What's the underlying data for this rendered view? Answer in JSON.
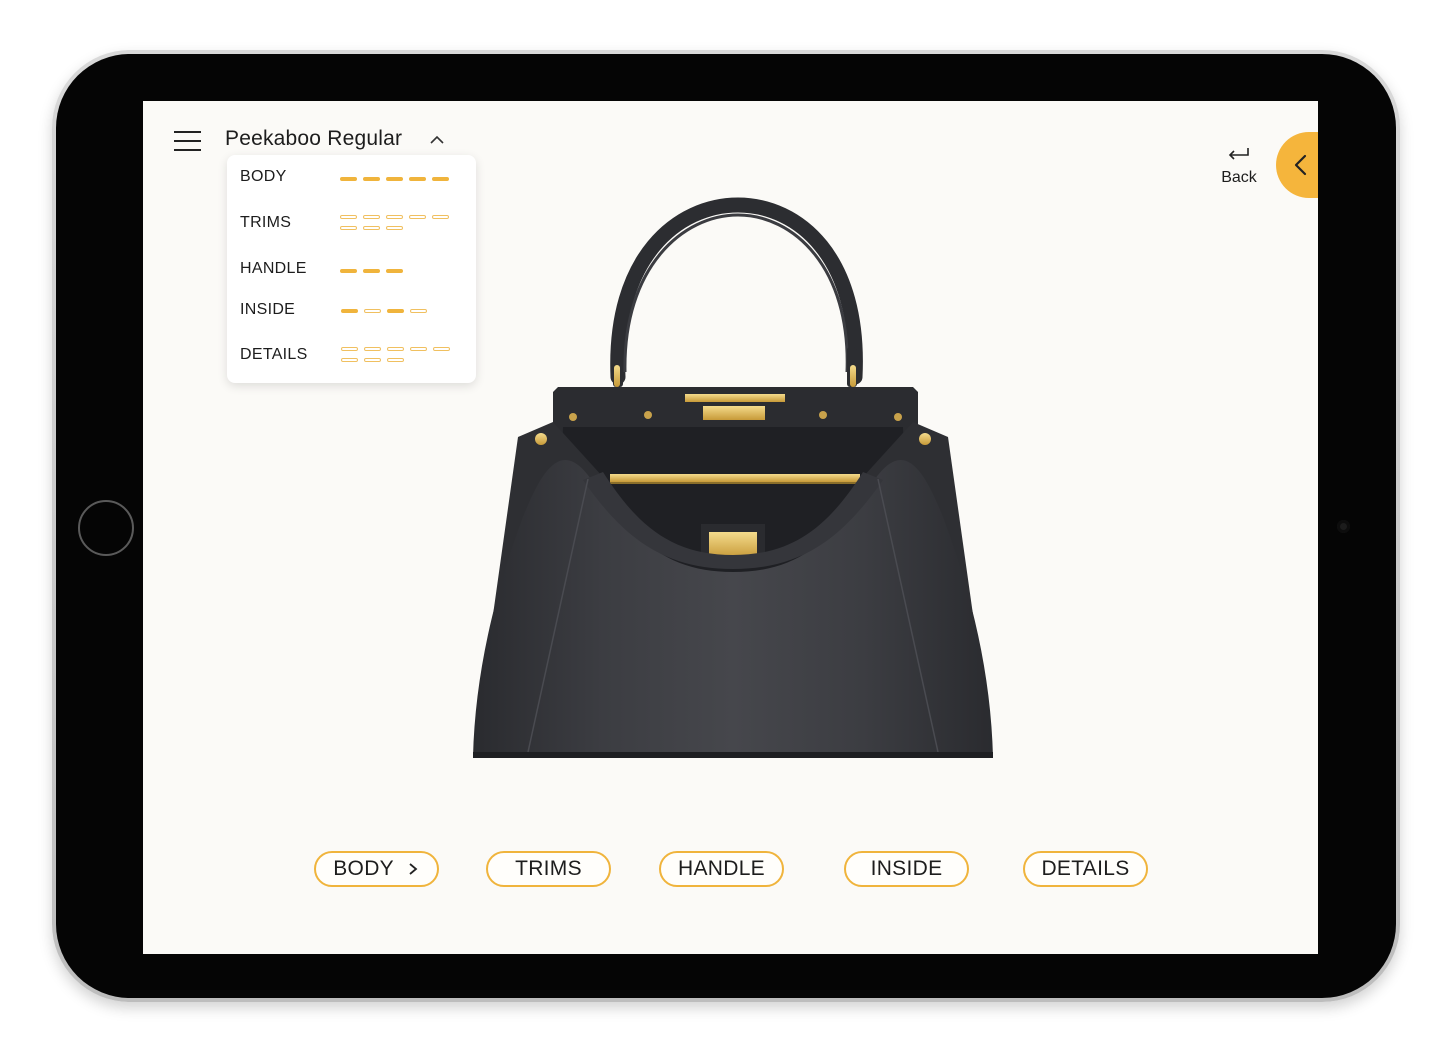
{
  "header": {
    "title": "Peekaboo Regular"
  },
  "panel": {
    "rows": [
      {
        "label": "BODY",
        "filled": 5,
        "total": 5,
        "pattern": "fffff"
      },
      {
        "label": "TRIMS",
        "filled": 0,
        "total": 8,
        "pattern": "oooooooo"
      },
      {
        "label": "HANDLE",
        "filled": 3,
        "total": 3,
        "pattern": "fff"
      },
      {
        "label": "INSIDE",
        "filled": 2,
        "total": 4,
        "pattern": "fofo"
      },
      {
        "label": "DETAILS",
        "filled": 0,
        "total": 8,
        "pattern": "oooooooo"
      }
    ]
  },
  "nav": {
    "back_label": "Back",
    "back_icon": "return-arrow-icon",
    "collapse_icon": "chevron-left-icon",
    "menu_icon": "hamburger-menu-icon",
    "dropdown_icon": "chevron-up-icon"
  },
  "product": {
    "image": "black-handbag"
  },
  "tabs": [
    {
      "label": "BODY",
      "active": true
    },
    {
      "label": "TRIMS",
      "active": false
    },
    {
      "label": "HANDLE",
      "active": false
    },
    {
      "label": "INSIDE",
      "active": false
    },
    {
      "label": "DETAILS",
      "active": false
    }
  ],
  "colors": {
    "accent": "#f5b53c",
    "screen_bg": "#fbfaf7",
    "text": "#1d1d1d"
  }
}
